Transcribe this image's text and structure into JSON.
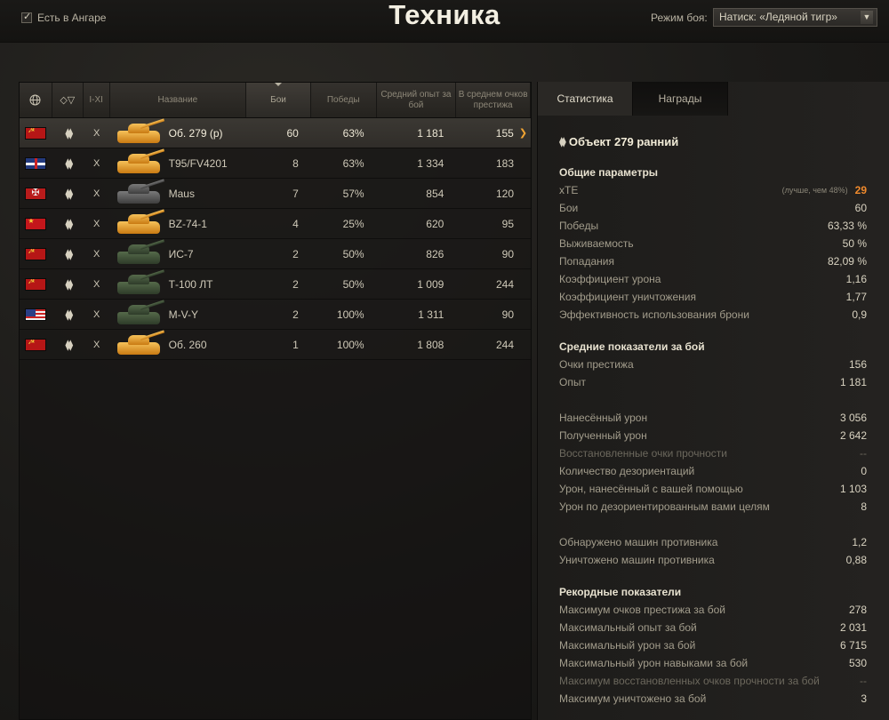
{
  "header": {
    "hangar_filter_label": "Есть в Ангаре",
    "title": "Техника",
    "mode_label": "Режим боя:",
    "mode_value": "Натиск: «Ледяной тигр»"
  },
  "table": {
    "columns": {
      "tier": "I-XI",
      "name": "Название",
      "battles": "Бои",
      "wins": "Победы",
      "avg_xp": "Средний опыт за бой",
      "avg_prestige": "В среднем очков престижа"
    },
    "rows": [
      {
        "nation": "ussr",
        "tier": "X",
        "name": "Об. 279 (р)",
        "battles": "60",
        "wins": "63%",
        "avg_xp": "1 181",
        "avg_prestige": "155",
        "style": "prem",
        "selected": true
      },
      {
        "nation": "uk",
        "tier": "X",
        "name": "T95/FV4201",
        "battles": "8",
        "wins": "63%",
        "avg_xp": "1 334",
        "avg_prestige": "183",
        "style": "prem"
      },
      {
        "nation": "germany",
        "tier": "X",
        "name": "Maus",
        "battles": "7",
        "wins": "57%",
        "avg_xp": "854",
        "avg_prestige": "120",
        "style": "grey"
      },
      {
        "nation": "china",
        "tier": "X",
        "name": "BZ-74-1",
        "battles": "4",
        "wins": "25%",
        "avg_xp": "620",
        "avg_prestige": "95",
        "style": "prem"
      },
      {
        "nation": "ussr",
        "tier": "X",
        "name": "ИС-7",
        "battles": "2",
        "wins": "50%",
        "avg_xp": "826",
        "avg_prestige": "90",
        "style": "std"
      },
      {
        "nation": "ussr",
        "tier": "X",
        "name": "Т-100 ЛТ",
        "battles": "2",
        "wins": "50%",
        "avg_xp": "1 009",
        "avg_prestige": "244",
        "style": "std"
      },
      {
        "nation": "usa",
        "tier": "X",
        "name": "M-V-Y",
        "battles": "2",
        "wins": "100%",
        "avg_xp": "1 311",
        "avg_prestige": "90",
        "style": "std"
      },
      {
        "nation": "ussr",
        "tier": "X",
        "name": "Об. 260",
        "battles": "1",
        "wins": "100%",
        "avg_xp": "1 808",
        "avg_prestige": "244",
        "style": "prem"
      }
    ]
  },
  "tabs": [
    "Статистика",
    "Награды"
  ],
  "vehicle_title": "Объект 279 ранний",
  "general": {
    "title": "Общие параметры",
    "xte_label": "xTE",
    "xte_note": "(лучше, чем 48%)",
    "xte_value": "29",
    "rows": [
      {
        "label": "Бои",
        "value": "60"
      },
      {
        "label": "Победы",
        "value": "63,33 %"
      },
      {
        "label": "Выживаемость",
        "value": "50 %"
      },
      {
        "label": "Попадания",
        "value": "82,09 %"
      },
      {
        "label": "Коэффициент урона",
        "value": "1,16"
      },
      {
        "label": "Коэффициент уничтожения",
        "value": "1,77"
      },
      {
        "label": "Эффективность использования брони",
        "value": "0,9"
      }
    ]
  },
  "average": {
    "title": "Средние показатели за бой",
    "rows": [
      {
        "label": "Очки престижа",
        "value": "156"
      },
      {
        "label": "Опыт",
        "value": "1 181"
      },
      {
        "label": "",
        "value": ""
      },
      {
        "label": "Нанесённый урон",
        "value": "3 056"
      },
      {
        "label": "Полученный урон",
        "value": "2 642"
      },
      {
        "label": "Восстановленные очки прочности",
        "value": "--",
        "dim": true
      },
      {
        "label": "Количество дезориентаций",
        "value": "0"
      },
      {
        "label": "Урон, нанесённый с вашей помощью",
        "value": "1 103"
      },
      {
        "label": "Урон по дезориентированным вами целям",
        "value": "8"
      },
      {
        "label": "",
        "value": ""
      },
      {
        "label": "Обнаружено машин противника",
        "value": "1,2"
      },
      {
        "label": "Уничтожено машин противника",
        "value": "0,88"
      }
    ]
  },
  "records": {
    "title": "Рекордные показатели",
    "rows": [
      {
        "label": "Максимум очков престижа за бой",
        "value": "278"
      },
      {
        "label": "Максимальный опыт за бой",
        "value": "2 031"
      },
      {
        "label": "Максимальный урон за бой",
        "value": "6 715"
      },
      {
        "label": "Максимальный урон навыками за бой",
        "value": "530"
      },
      {
        "label": "Максимум восстановленных очков прочности за бой",
        "value": "--",
        "dim": true
      },
      {
        "label": "Максимум уничтожено за бой",
        "value": "3"
      }
    ]
  }
}
